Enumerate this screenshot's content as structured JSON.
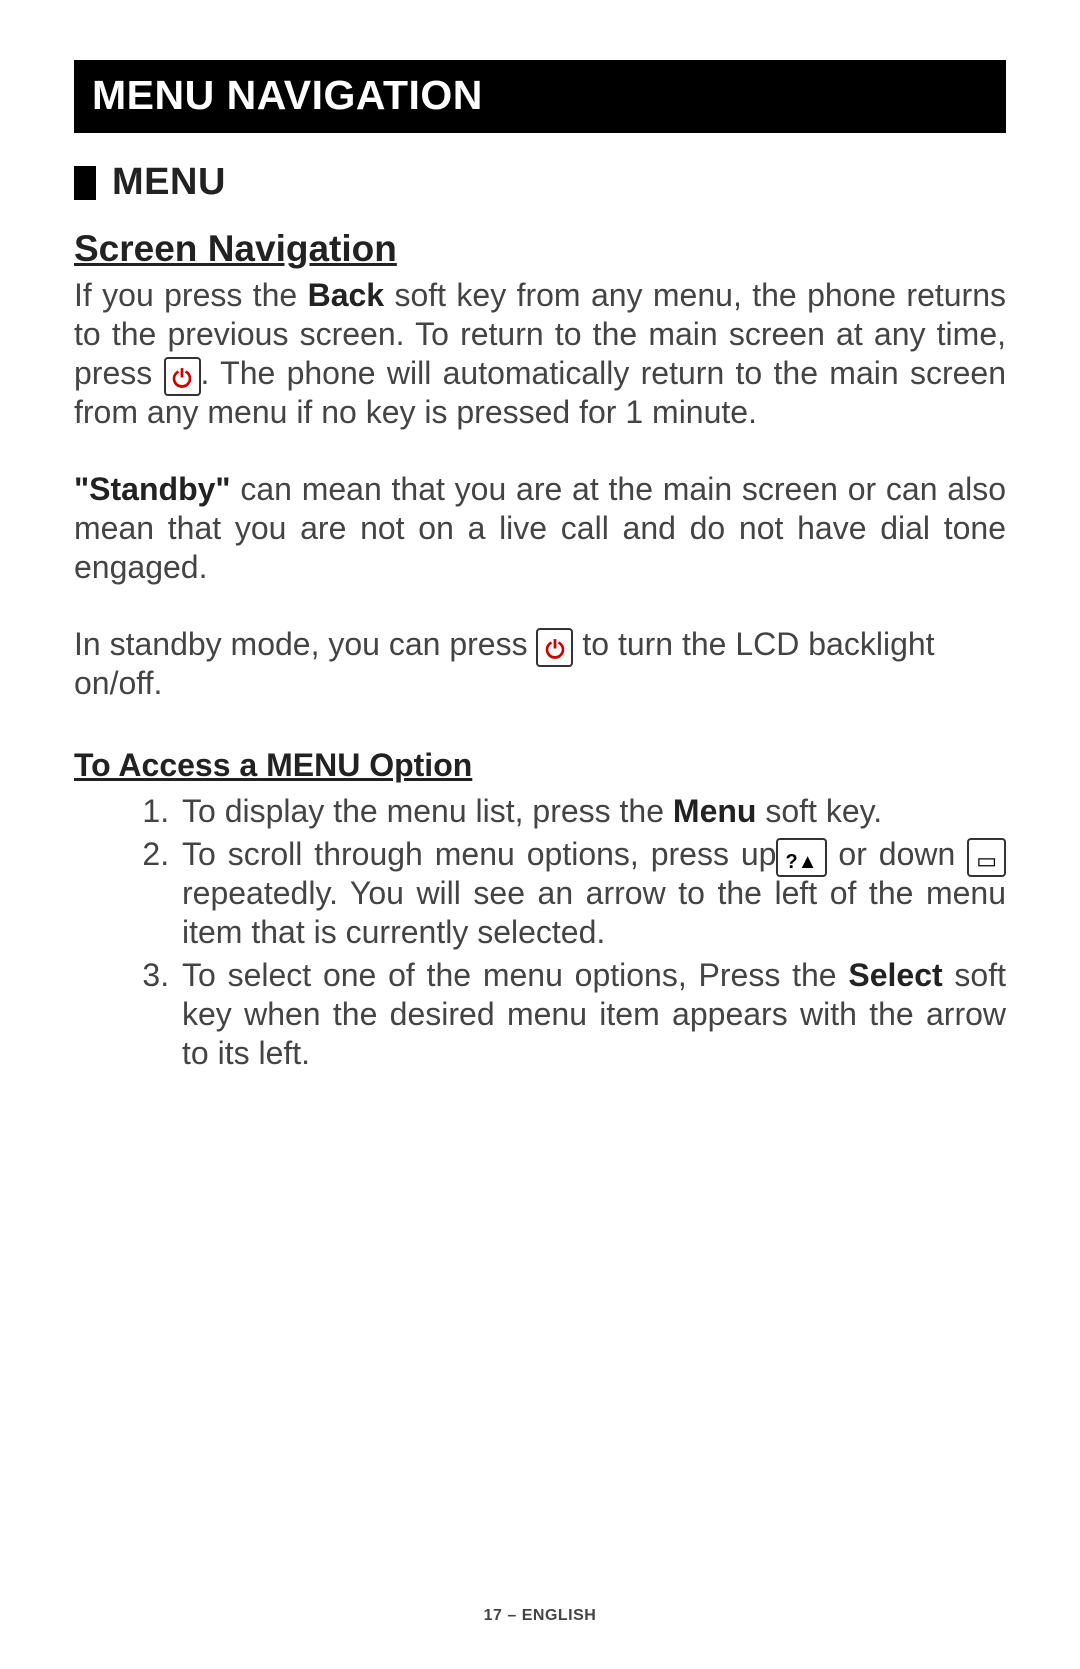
{
  "banner": "MENU NAVIGATION",
  "section_menu": "MENU",
  "sub_heading": "Screen Navigation",
  "p1a": "If you press the ",
  "p1_back": "Back",
  "p1b": " soft key from any menu, the phone returns to the previous screen.  To return to the main screen at any time, press ",
  "p1c": ".  The phone will automatically return to the main screen from any menu if no key is pressed for 1 minute.",
  "p2_standby": "\"Standby\"",
  "p2": " can mean that you are at the main screen or can also mean that you are not on a live call and do not have dial tone engaged.",
  "p3a": "In standby mode, you can press ",
  "p3b": " to turn the LCD backlight on/off.",
  "list_heading": "To Access a MENU Option",
  "step1a": "To display the menu list, press the ",
  "step1_menu": "Menu",
  "step1b": " soft key.",
  "step2a": "To scroll through menu options, press up",
  "step2b": " or down ",
  "step2c": " repeatedly.  You will see an arrow to the left of the menu item that is currently selected.",
  "step3a": "To select one of the menu options, Press the ",
  "step3_select": "Select",
  "step3b": " soft key when the desired menu item appears with the arrow to its left.",
  "footer": "17 – ENGLISH"
}
